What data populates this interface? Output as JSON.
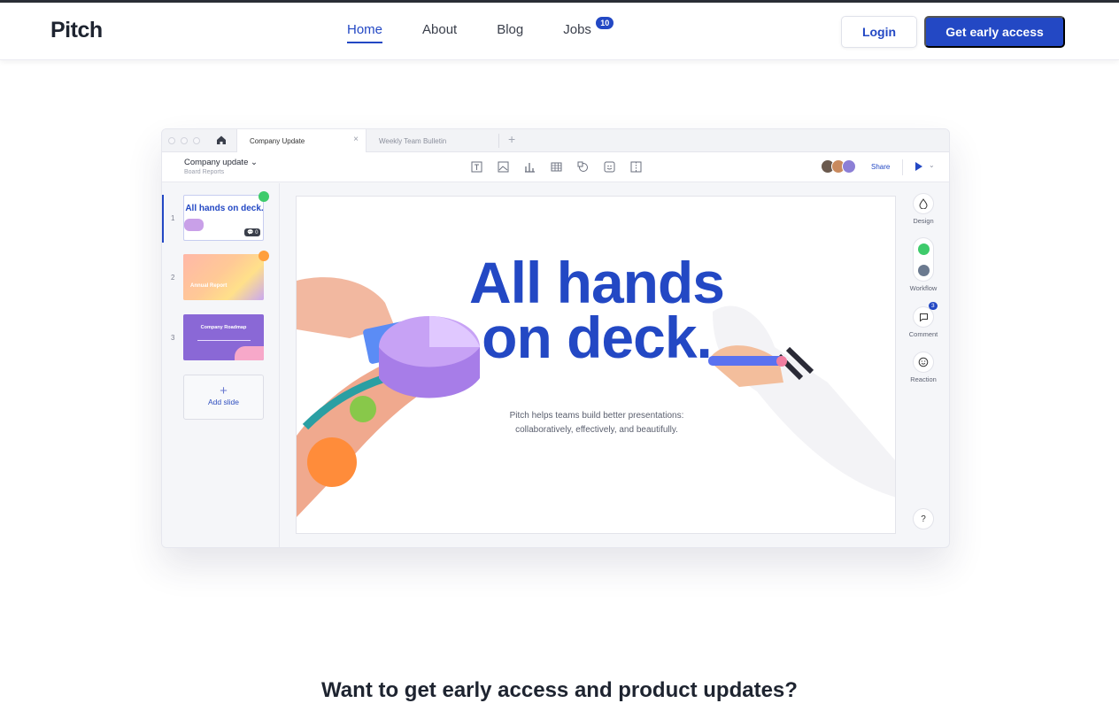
{
  "nav": {
    "logo": "Pitch",
    "links": [
      {
        "label": "Home"
      },
      {
        "label": "About"
      },
      {
        "label": "Blog"
      },
      {
        "label": "Jobs",
        "badge": "10"
      }
    ],
    "login_label": "Login",
    "cta_label": "Get early access"
  },
  "app": {
    "tabs": [
      {
        "label": "Company Update",
        "close": "×"
      },
      {
        "label": "Weekly Team Bulletin"
      }
    ],
    "tab_add": "+",
    "doc_title": "Company update ⌄",
    "doc_subtitle": "Board Reports",
    "share_label": "Share",
    "play_chevron": "⌄",
    "slides": [
      {
        "number": "1",
        "title": "All hands on deck.",
        "status_color": "#3ecb6b",
        "badge": "💬 0"
      },
      {
        "number": "2",
        "title": "Annual Report",
        "status_color": "#ff9f3d"
      },
      {
        "number": "3",
        "title": "Company Roadmap"
      }
    ],
    "add_slide_icon": "+",
    "add_slide_label": "Add slide",
    "slide": {
      "title_line1": "All hands",
      "title_line2": "on deck.",
      "subtitle_line1": "Pitch helps teams build better presentations:",
      "subtitle_line2": "collaboratively, effectively, and beautifully."
    },
    "right_panel": {
      "design_label": "Design",
      "workflow_label": "Workflow",
      "comment_label": "Comment",
      "comment_count": "3",
      "reaction_label": "Reaction",
      "help_label": "?"
    }
  },
  "cta": {
    "heading": "Want to get early access and product updates?"
  },
  "colors": {
    "brand_blue": "#2348c4",
    "success_green": "#3ecb6b",
    "warning_orange": "#ff9f3d"
  }
}
